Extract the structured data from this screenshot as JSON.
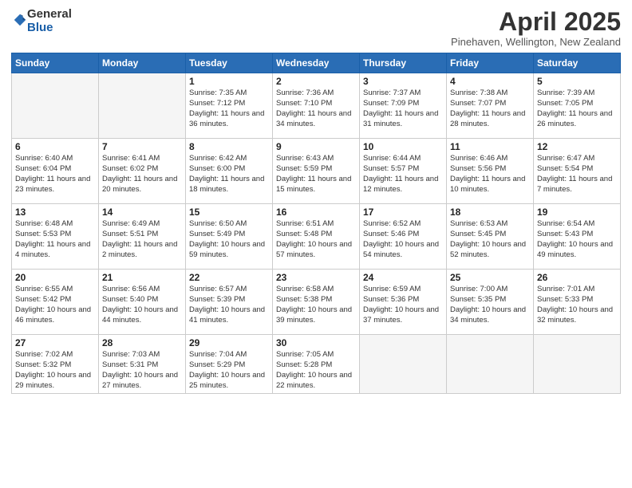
{
  "logo": {
    "general": "General",
    "blue": "Blue"
  },
  "header": {
    "month": "April 2025",
    "location": "Pinehaven, Wellington, New Zealand"
  },
  "weekdays": [
    "Sunday",
    "Monday",
    "Tuesday",
    "Wednesday",
    "Thursday",
    "Friday",
    "Saturday"
  ],
  "weeks": [
    [
      {
        "day": "",
        "info": ""
      },
      {
        "day": "",
        "info": ""
      },
      {
        "day": "1",
        "info": "Sunrise: 7:35 AM\nSunset: 7:12 PM\nDaylight: 11 hours and 36 minutes."
      },
      {
        "day": "2",
        "info": "Sunrise: 7:36 AM\nSunset: 7:10 PM\nDaylight: 11 hours and 34 minutes."
      },
      {
        "day": "3",
        "info": "Sunrise: 7:37 AM\nSunset: 7:09 PM\nDaylight: 11 hours and 31 minutes."
      },
      {
        "day": "4",
        "info": "Sunrise: 7:38 AM\nSunset: 7:07 PM\nDaylight: 11 hours and 28 minutes."
      },
      {
        "day": "5",
        "info": "Sunrise: 7:39 AM\nSunset: 7:05 PM\nDaylight: 11 hours and 26 minutes."
      }
    ],
    [
      {
        "day": "6",
        "info": "Sunrise: 6:40 AM\nSunset: 6:04 PM\nDaylight: 11 hours and 23 minutes."
      },
      {
        "day": "7",
        "info": "Sunrise: 6:41 AM\nSunset: 6:02 PM\nDaylight: 11 hours and 20 minutes."
      },
      {
        "day": "8",
        "info": "Sunrise: 6:42 AM\nSunset: 6:00 PM\nDaylight: 11 hours and 18 minutes."
      },
      {
        "day": "9",
        "info": "Sunrise: 6:43 AM\nSunset: 5:59 PM\nDaylight: 11 hours and 15 minutes."
      },
      {
        "day": "10",
        "info": "Sunrise: 6:44 AM\nSunset: 5:57 PM\nDaylight: 11 hours and 12 minutes."
      },
      {
        "day": "11",
        "info": "Sunrise: 6:46 AM\nSunset: 5:56 PM\nDaylight: 11 hours and 10 minutes."
      },
      {
        "day": "12",
        "info": "Sunrise: 6:47 AM\nSunset: 5:54 PM\nDaylight: 11 hours and 7 minutes."
      }
    ],
    [
      {
        "day": "13",
        "info": "Sunrise: 6:48 AM\nSunset: 5:53 PM\nDaylight: 11 hours and 4 minutes."
      },
      {
        "day": "14",
        "info": "Sunrise: 6:49 AM\nSunset: 5:51 PM\nDaylight: 11 hours and 2 minutes."
      },
      {
        "day": "15",
        "info": "Sunrise: 6:50 AM\nSunset: 5:49 PM\nDaylight: 10 hours and 59 minutes."
      },
      {
        "day": "16",
        "info": "Sunrise: 6:51 AM\nSunset: 5:48 PM\nDaylight: 10 hours and 57 minutes."
      },
      {
        "day": "17",
        "info": "Sunrise: 6:52 AM\nSunset: 5:46 PM\nDaylight: 10 hours and 54 minutes."
      },
      {
        "day": "18",
        "info": "Sunrise: 6:53 AM\nSunset: 5:45 PM\nDaylight: 10 hours and 52 minutes."
      },
      {
        "day": "19",
        "info": "Sunrise: 6:54 AM\nSunset: 5:43 PM\nDaylight: 10 hours and 49 minutes."
      }
    ],
    [
      {
        "day": "20",
        "info": "Sunrise: 6:55 AM\nSunset: 5:42 PM\nDaylight: 10 hours and 46 minutes."
      },
      {
        "day": "21",
        "info": "Sunrise: 6:56 AM\nSunset: 5:40 PM\nDaylight: 10 hours and 44 minutes."
      },
      {
        "day": "22",
        "info": "Sunrise: 6:57 AM\nSunset: 5:39 PM\nDaylight: 10 hours and 41 minutes."
      },
      {
        "day": "23",
        "info": "Sunrise: 6:58 AM\nSunset: 5:38 PM\nDaylight: 10 hours and 39 minutes."
      },
      {
        "day": "24",
        "info": "Sunrise: 6:59 AM\nSunset: 5:36 PM\nDaylight: 10 hours and 37 minutes."
      },
      {
        "day": "25",
        "info": "Sunrise: 7:00 AM\nSunset: 5:35 PM\nDaylight: 10 hours and 34 minutes."
      },
      {
        "day": "26",
        "info": "Sunrise: 7:01 AM\nSunset: 5:33 PM\nDaylight: 10 hours and 32 minutes."
      }
    ],
    [
      {
        "day": "27",
        "info": "Sunrise: 7:02 AM\nSunset: 5:32 PM\nDaylight: 10 hours and 29 minutes."
      },
      {
        "day": "28",
        "info": "Sunrise: 7:03 AM\nSunset: 5:31 PM\nDaylight: 10 hours and 27 minutes."
      },
      {
        "day": "29",
        "info": "Sunrise: 7:04 AM\nSunset: 5:29 PM\nDaylight: 10 hours and 25 minutes."
      },
      {
        "day": "30",
        "info": "Sunrise: 7:05 AM\nSunset: 5:28 PM\nDaylight: 10 hours and 22 minutes."
      },
      {
        "day": "",
        "info": ""
      },
      {
        "day": "",
        "info": ""
      },
      {
        "day": "",
        "info": ""
      }
    ]
  ]
}
